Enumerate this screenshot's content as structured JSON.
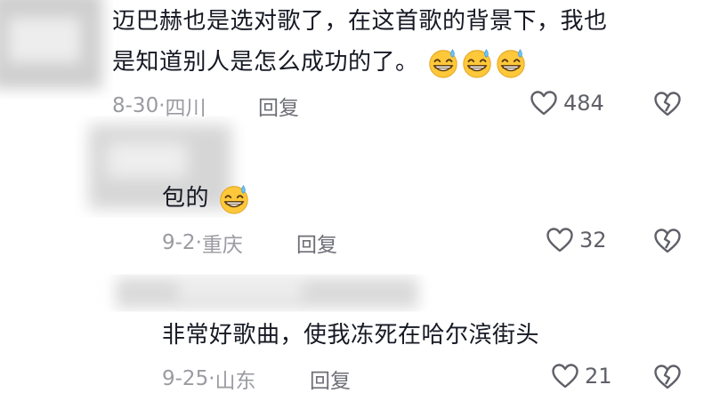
{
  "comments": [
    {
      "line1": "迈巴赫也是选对歌了，在这首歌的背景下，我也",
      "line2": "是知道别人是怎么成功的了。",
      "emoji_count": 3,
      "emoji": "laughing-sweat",
      "date": "8-30·",
      "location": "四川",
      "reply_label": "回复",
      "likes": "484"
    },
    {
      "line1": "包的",
      "emoji_count": 1,
      "emoji": "laughing-sweat",
      "date": "9-2·",
      "location": "重庆",
      "reply_label": "回复",
      "likes": "32"
    },
    {
      "line1": "非常好歌曲，使我冻死在哈尔滨街头",
      "emoji_count": 0,
      "date": "9-25·",
      "location": "山东",
      "reply_label": "回复",
      "likes": "21"
    }
  ],
  "colors": {
    "text": "#161823",
    "meta": "#9a9ba1",
    "reply": "#6e6f76",
    "emoji_face": "#ffc83a"
  }
}
